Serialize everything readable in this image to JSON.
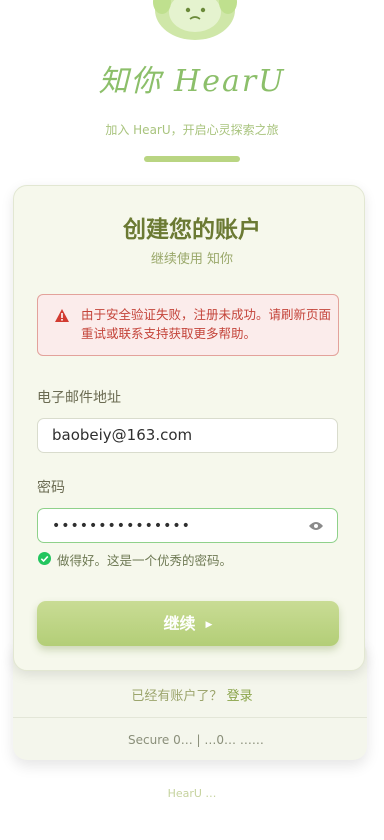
{
  "brand": {
    "logo_text": "知你 HearU",
    "tagline": "加入 HearU，开启心灵探索之旅"
  },
  "card": {
    "title": "创建您的账户",
    "subtitle": "继续使用 知你"
  },
  "alert": {
    "icon": "warning-icon",
    "message": "由于安全验证失败，注册未成功。请刷新页面重试或联系支持获取更多帮助。"
  },
  "email": {
    "label": "电子邮件地址",
    "value": "baobeiy@163.com"
  },
  "password": {
    "label": "密码",
    "value": "•••••••••••••••",
    "hint": "做得好。这是一个优秀的密码。"
  },
  "submit": {
    "label": "继续"
  },
  "login": {
    "prompt": "已经有账户了？",
    "link": "登录"
  },
  "secure": {
    "text": "Secure 0… | …0… ……"
  },
  "footer": {
    "text": "HearU …"
  },
  "colors": {
    "accent": "#b3ce77",
    "error": "#c4443a",
    "success": "#22c55e"
  }
}
